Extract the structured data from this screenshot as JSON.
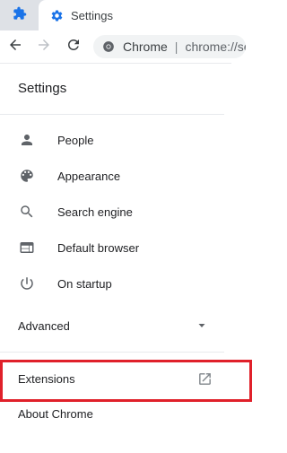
{
  "tab": {
    "title": "Settings"
  },
  "omnibox": {
    "chip_label": "Chrome",
    "separator": "|",
    "url": "chrome://settings"
  },
  "settings": {
    "heading": "Settings"
  },
  "nav": {
    "items": [
      {
        "label": "People",
        "icon": "person-icon"
      },
      {
        "label": "Appearance",
        "icon": "palette-icon"
      },
      {
        "label": "Search engine",
        "icon": "search-icon"
      },
      {
        "label": "Default browser",
        "icon": "browser-icon"
      },
      {
        "label": "On startup",
        "icon": "power-icon"
      }
    ]
  },
  "advanced": {
    "label": "Advanced"
  },
  "extensions": {
    "label": "Extensions",
    "highlight_color": "#e0202a"
  },
  "about": {
    "label": "About Chrome"
  },
  "colors": {
    "accent": "#1a73e8",
    "icon": "#5f6368",
    "text": "#202124"
  }
}
